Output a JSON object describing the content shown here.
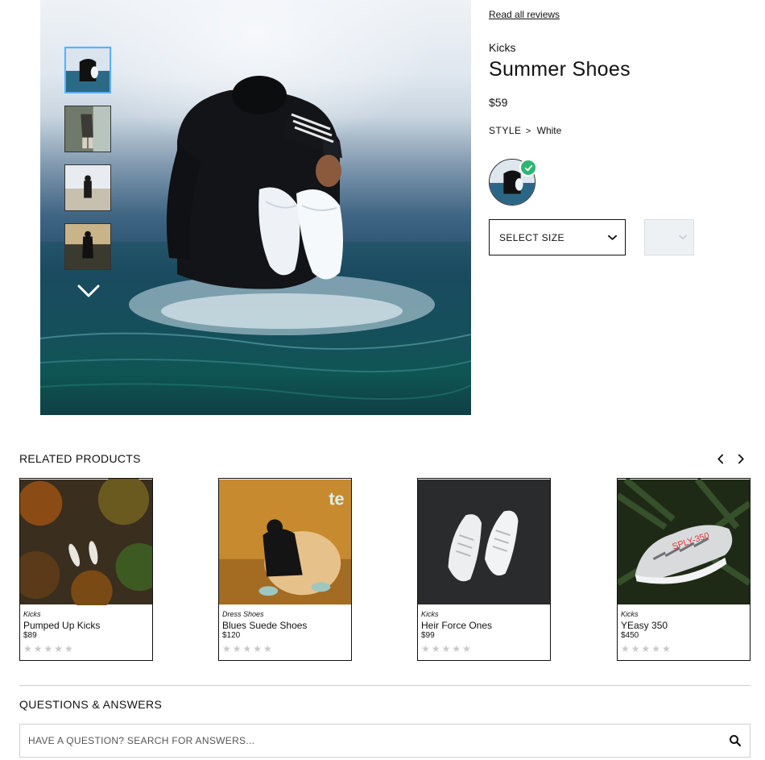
{
  "gallery": {
    "main_alt_icon": "product-photo",
    "thumbnail_count": 4,
    "down_icon": "chevron-down-icon"
  },
  "product": {
    "read_reviews_label": "Read all reviews",
    "category": "Kicks",
    "name": "Summer Shoes",
    "price": "$59",
    "style_label": "STYLE",
    "style_chevron": ">",
    "style_value": "White",
    "size_select_label": "SELECT SIZE"
  },
  "related": {
    "title": "RELATED PRODUCTS",
    "items": [
      {
        "category": "Kicks",
        "name": "Pumped Up Kicks",
        "price": "$89",
        "stars": "★★★★★",
        "rating": 0
      },
      {
        "category": "Dress Shoes",
        "name": "Blues Suede Shoes",
        "price": "$120",
        "stars": "★★★★★",
        "rating": 0
      },
      {
        "category": "Kicks",
        "name": "Heir Force Ones",
        "price": "$99",
        "stars": "★★★★★",
        "rating": 0
      },
      {
        "category": "Kicks",
        "name": "YEasy 350",
        "price": "$450",
        "stars": "★★★★★",
        "rating": 0
      }
    ]
  },
  "qa": {
    "title": "QUESTIONS & ANSWERS",
    "search_placeholder": "HAVE A QUESTION? SEARCH FOR ANSWERS..."
  },
  "colors": {
    "check_badge": "#2bb673",
    "active_thumb_border": "#5ab0ff",
    "star_empty": "#c9c9c9"
  }
}
